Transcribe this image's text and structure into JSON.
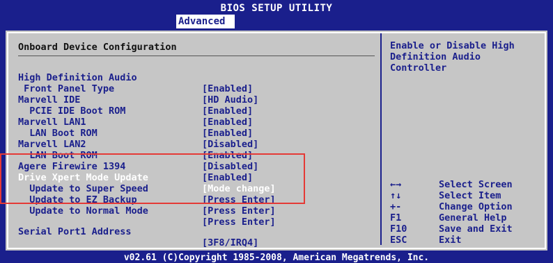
{
  "window": {
    "title": "BIOS SETUP UTILITY",
    "active_tab": "Advanced"
  },
  "panel": {
    "header": "Onboard Device Configuration"
  },
  "settings": [
    {
      "label": "High Definition Audio",
      "value": "[Enabled]"
    },
    {
      "label": " Front Panel Type",
      "value": "[HD Audio]"
    },
    {
      "label": "Marvell IDE",
      "value": "[Enabled]"
    },
    {
      "label": "  PCIE IDE Boot ROM",
      "value": "[Enabled]"
    },
    {
      "label": "Marvell LAN1",
      "value": "[Enabled]"
    },
    {
      "label": "  LAN Boot ROM",
      "value": "[Disabled]"
    },
    {
      "label": "Marvell LAN2",
      "value": "[Enabled]"
    },
    {
      "label": "  LAN Boot ROM",
      "value": "[Disabled]"
    },
    {
      "label": "Agere Firewire 1394",
      "value": "[Enabled]"
    },
    {
      "label": "Drive Xpert Mode Update",
      "value": "[Mode change]"
    },
    {
      "label": "  Update to Super Speed",
      "value": "[Press Enter]"
    },
    {
      "label": "  Update to EZ Backup",
      "value": "[Press Enter]"
    },
    {
      "label": "  Update to Normal Mode",
      "value": "[Press Enter]"
    },
    {
      "label": "Serial Port1 Address",
      "value": "[3F8/IRQ4]"
    }
  ],
  "help": {
    "text": "Enable or Disable High Definition Audio Controller"
  },
  "keys": [
    {
      "key": "←→",
      "desc": "Select Screen"
    },
    {
      "key": "↑↓",
      "desc": "Select Item"
    },
    {
      "key": "+-",
      "desc": "Change Option"
    },
    {
      "key": "F1",
      "desc": "General Help"
    },
    {
      "key": "F10",
      "desc": "Save and Exit"
    },
    {
      "key": "ESC",
      "desc": "Exit"
    }
  ],
  "footer": "v02.61 (C)Copyright 1985-2008, American Megatrends, Inc.",
  "colors": {
    "background": "#1a1f8c",
    "panel": "#c6c6c6",
    "highlight_text": "#ffffff",
    "annotation_box": "#e53935"
  }
}
